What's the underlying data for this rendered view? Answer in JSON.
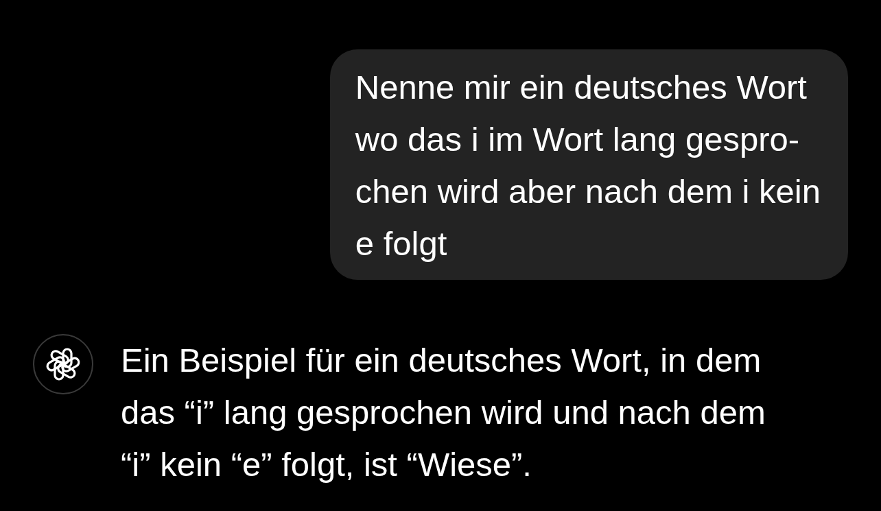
{
  "messages": [
    {
      "kind": "outgoing",
      "text": "Nenne mir ein deutsches Wort\nwo das i im Wort lang gespro-\nchen wird aber nach dem i kein\ne folgt"
    },
    {
      "kind": "incoming",
      "text": "Ein Beispiel für ein deutsches Wort, in dem\ndas “i” lang gesprochen wird und nach dem\n“i” kein “e” folgt, ist “Wiese”."
    }
  ]
}
